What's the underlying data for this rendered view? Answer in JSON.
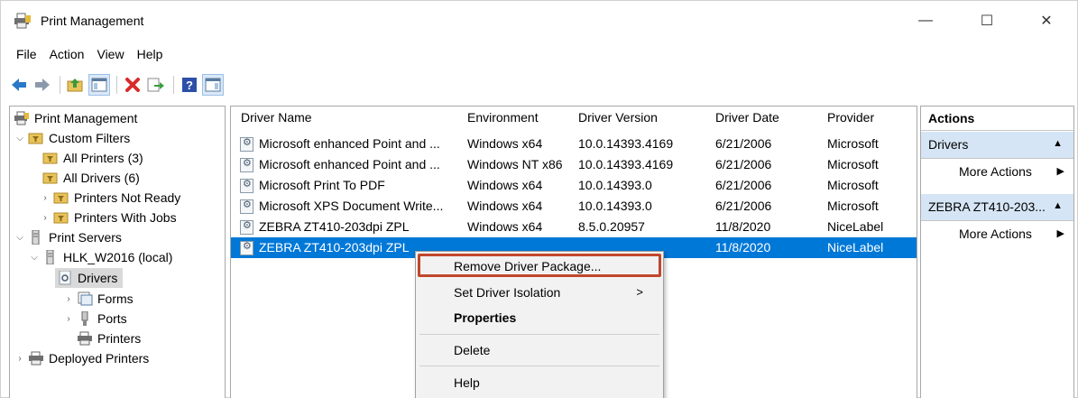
{
  "window": {
    "title": "Print Management",
    "controls": {
      "minimize": "—",
      "maximize": "☐",
      "close": "✕"
    }
  },
  "menu": [
    "File",
    "Action",
    "View",
    "Help"
  ],
  "tree": {
    "root": "Print Management",
    "custom_filters": "Custom Filters",
    "all_printers": "All Printers (3)",
    "all_drivers": "All Drivers (6)",
    "printers_not_ready": "Printers Not Ready",
    "printers_with_jobs": "Printers With Jobs",
    "print_servers": "Print Servers",
    "server": "HLK_W2016 (local)",
    "drivers": "Drivers",
    "forms": "Forms",
    "ports": "Ports",
    "printers": "Printers",
    "deployed_printers": "Deployed Printers"
  },
  "table": {
    "columns": [
      "Driver Name",
      "Environment",
      "Driver Version",
      "Driver Date",
      "Provider"
    ],
    "rows": [
      [
        "Microsoft enhanced Point and ...",
        "Windows x64",
        "10.0.14393.4169",
        "6/21/2006",
        "Microsoft"
      ],
      [
        "Microsoft enhanced Point and ...",
        "Windows NT x86",
        "10.0.14393.4169",
        "6/21/2006",
        "Microsoft"
      ],
      [
        "Microsoft Print To PDF",
        "Windows x64",
        "10.0.14393.0",
        "6/21/2006",
        "Microsoft"
      ],
      [
        "Microsoft XPS Document Write...",
        "Windows x64",
        "10.0.14393.0",
        "6/21/2006",
        "Microsoft"
      ],
      [
        "ZEBRA ZT410-203dpi ZPL",
        "Windows x64",
        "8.5.0.20957",
        "11/8/2020",
        "NiceLabel"
      ],
      [
        "ZEBRA ZT410-203dpi ZPL",
        "",
        "",
        "11/8/2020",
        "NiceLabel"
      ]
    ],
    "selected_row": 5
  },
  "actions": {
    "header": "Actions",
    "section1": "Drivers",
    "section1_more": "More Actions",
    "section2": "ZEBRA ZT410-203...",
    "section2_more": "More Actions"
  },
  "context_menu": {
    "remove": "Remove Driver Package...",
    "isolation": "Set Driver Isolation",
    "properties": "Properties",
    "delete": "Delete",
    "help": "Help",
    "submenu_arrow": ">"
  },
  "colors": {
    "selection": "#0078d7",
    "actions_section": "#d5e5f5",
    "highlight_box": "#c0472d"
  }
}
